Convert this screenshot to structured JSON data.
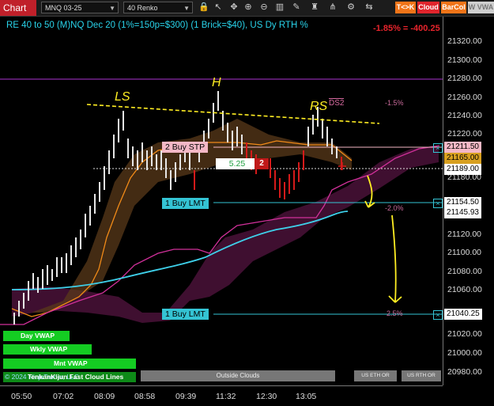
{
  "toolbar": {
    "chart_tab": "Chart",
    "instrument": "MNQ 03-25",
    "bar_type": "40 Renko",
    "pill_tk": "T<>K",
    "pill_cloud": "Cloud",
    "pill_barcol": "BarCol",
    "pill_wvwa": "W VWA",
    "icons": [
      "lock-icon",
      "pointer-icon",
      "crosshair-icon",
      "zoom-in-icon",
      "zoom-out-icon",
      "bars-icon",
      "drawing-icon",
      "strategy-icon",
      "indicator-icon",
      "properties-icon",
      "trade-icon"
    ]
  },
  "header": {
    "title": "RE 40 to 50 (M)NQ Dec 20 (1%=150p=$300) (1 Brick=$40), US Dy RTH %",
    "pnl": "-1.85% = -400.25"
  },
  "y_axis": {
    "ticks": [
      "21320.00",
      "21300.00",
      "21280.00",
      "21260.00",
      "21240.00",
      "21220.00",
      "21200.00",
      "21180.00",
      "21160.00",
      "21140.00",
      "21120.00",
      "21100.00",
      "21080.00",
      "21060.00",
      "21040.00",
      "21020.00",
      "21000.00",
      "20980.00"
    ],
    "price_tags": {
      "stop": "21211.50",
      "last": "21189.00",
      "limit1": "21154.50",
      "cyan_line": "21145.93",
      "limit2": "21040.25",
      "hidden": "21165.00"
    }
  },
  "x_axis": {
    "ticks": [
      "05:50",
      "07:02",
      "08:09",
      "08:58",
      "09:39",
      "11:32",
      "12:30",
      "13:05"
    ]
  },
  "orders": {
    "stop_label": "2 Buy STP",
    "limit1_label": "1 Buy LMT",
    "limit2_label": "1 Buy LMT",
    "position_price": "5.25",
    "position_qty": "2",
    "close_glyph": "×"
  },
  "annotations": {
    "ls": "LS",
    "h": "H",
    "rs": "RS",
    "ds2": "DS2",
    "pct_top": "-1.5%",
    "pct_mid": "-2.0%",
    "pct_bot": "2.5%"
  },
  "bottom": {
    "vwap_buttons": [
      "Day VWAP",
      "Wkly VWAP",
      "Mnt VWAP"
    ],
    "copyright": "© 2024 NinjaTrader, LLC",
    "clouds_label": "TenkanKijun Fast Cloud Lines",
    "outside_clouds": "Outside Clouds",
    "us_eth": "US ETH OR",
    "us_rth": "US RTH OR"
  },
  "colors": {
    "accent_cyan": "#29d3ea",
    "stop_pink": "#f4b8c6",
    "loss_red": "#e8242c",
    "cloud_purple": "#5a1540",
    "bull_green": "#14cc22"
  }
}
